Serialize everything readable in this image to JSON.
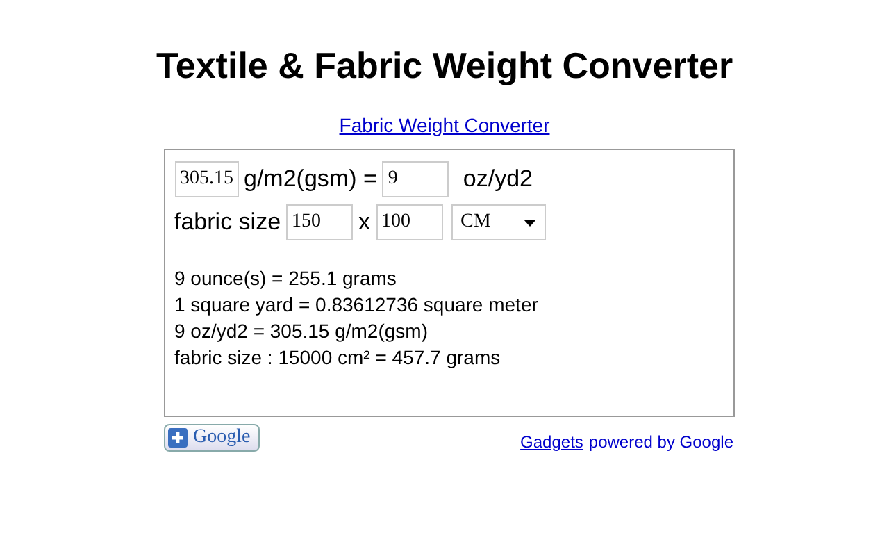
{
  "title": "Textile & Fabric Weight Converter",
  "link": "Fabric Weight Converter",
  "weight_row": {
    "gsm_value": "305.15",
    "gsm_label": "g/m2(gsm) =",
    "oz_value": "9",
    "oz_label": "oz/yd2"
  },
  "size_row": {
    "label": "fabric size",
    "width_value": "150",
    "times": "x",
    "height_value": "100",
    "unit": "CM"
  },
  "results": [
    "9 ounce(s) = 255.1 grams",
    "1 square yard = 0.83612736 square meter",
    "9 oz/yd2 = 305.15 g/m2(gsm)",
    "fabric size : 15000 cm² = 457.7 grams"
  ],
  "footer": {
    "add_button": "Google",
    "gadgets_link": "Gadgets",
    "powered_by": "powered by Google"
  }
}
